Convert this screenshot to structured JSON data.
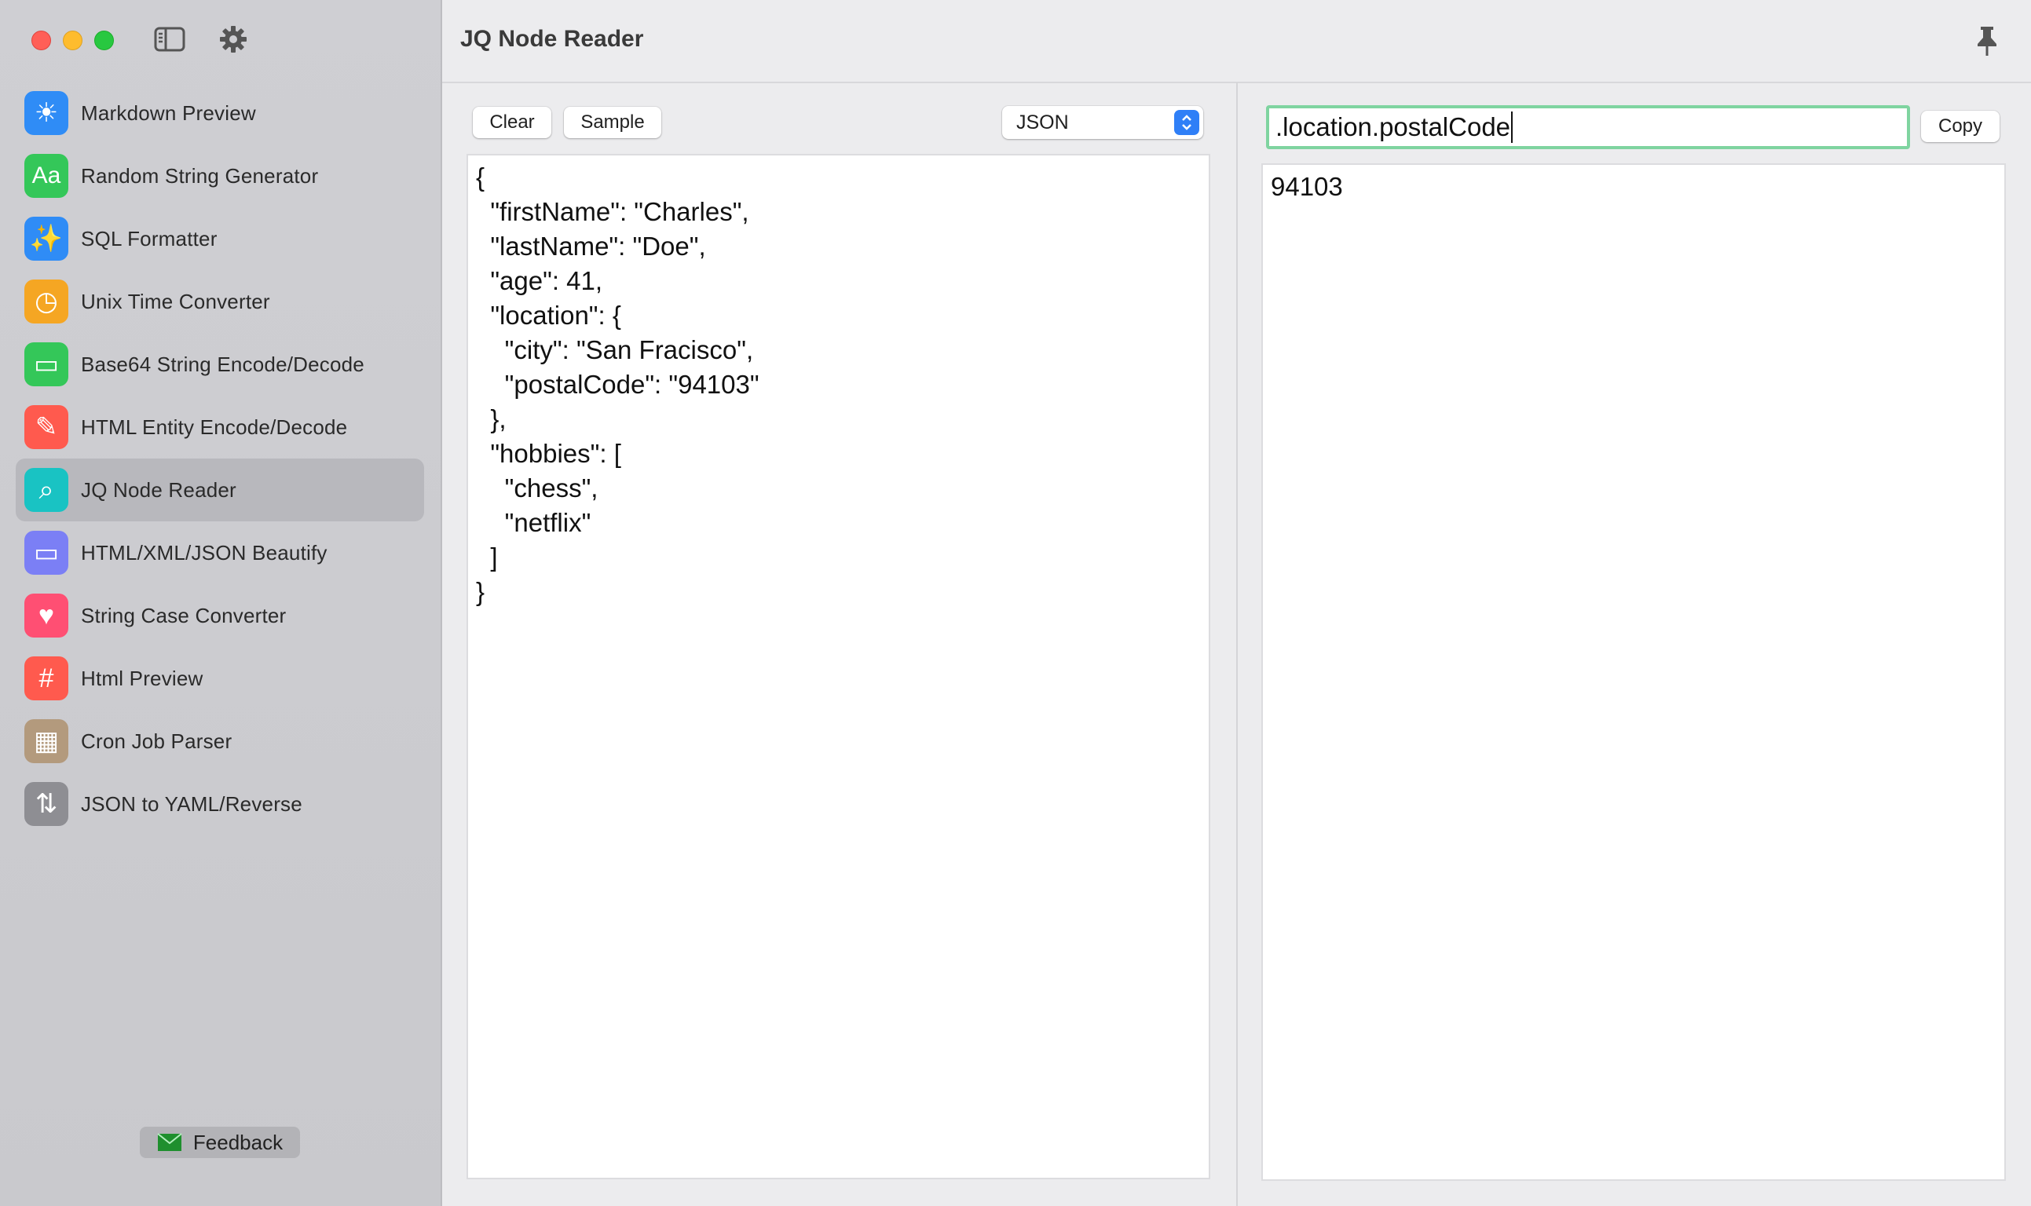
{
  "app": {
    "title": "JQ Node Reader"
  },
  "sidebar": {
    "items": [
      {
        "label": "Markdown Preview",
        "icon": "sun-icon",
        "color": "#2f8cf6",
        "glyph": "☀"
      },
      {
        "label": "Random String Generator",
        "icon": "text-aa-icon",
        "color": "#34c759",
        "glyph": "Aa"
      },
      {
        "label": "SQL Formatter",
        "icon": "magic-wand-icon",
        "color": "#2f8cf6",
        "glyph": "✨"
      },
      {
        "label": "Unix Time Converter",
        "icon": "timer-icon",
        "color": "#f5a623",
        "glyph": "◷"
      },
      {
        "label": "Base64 String Encode/Decode",
        "icon": "message-icon",
        "color": "#34c759",
        "glyph": "▭"
      },
      {
        "label": "HTML Entity Encode/Decode",
        "icon": "carrot-icon",
        "color": "#ff5a4e",
        "glyph": "✎"
      },
      {
        "label": "JQ Node Reader",
        "icon": "magnifier-icon",
        "color": "#19c3c3",
        "glyph": "⌕"
      },
      {
        "label": "HTML/XML/JSON Beautify",
        "icon": "laptop-icon",
        "color": "#7b7ff5",
        "glyph": "▭"
      },
      {
        "label": "String Case Converter",
        "icon": "heart-icon",
        "color": "#ff4f73",
        "glyph": "♥"
      },
      {
        "label": "Html Preview",
        "icon": "hashtag-icon",
        "color": "#ff5a4e",
        "glyph": "#"
      },
      {
        "label": "Cron Job Parser",
        "icon": "grid-icon",
        "color": "#b39a7d",
        "glyph": "▦"
      },
      {
        "label": "JSON to YAML/Reverse",
        "icon": "arrows-swap-icon",
        "color": "#8e8e93",
        "glyph": "⇅"
      }
    ],
    "active_index": 6,
    "feedback_label": "Feedback"
  },
  "left_pane": {
    "clear_label": "Clear",
    "sample_label": "Sample",
    "format_selected": "JSON",
    "input_text": "{\n  \"firstName\": \"Charles\",\n  \"lastName\": \"Doe\",\n  \"age\": 41,\n  \"location\": {\n    \"city\": \"San Fracisco\",\n    \"postalCode\": \"94103\"\n  },\n  \"hobbies\": [\n    \"chess\",\n    \"netflix\"\n  ]\n}"
  },
  "right_pane": {
    "query_value": ".location.postalCode",
    "copy_label": "Copy",
    "output_text": "94103"
  }
}
